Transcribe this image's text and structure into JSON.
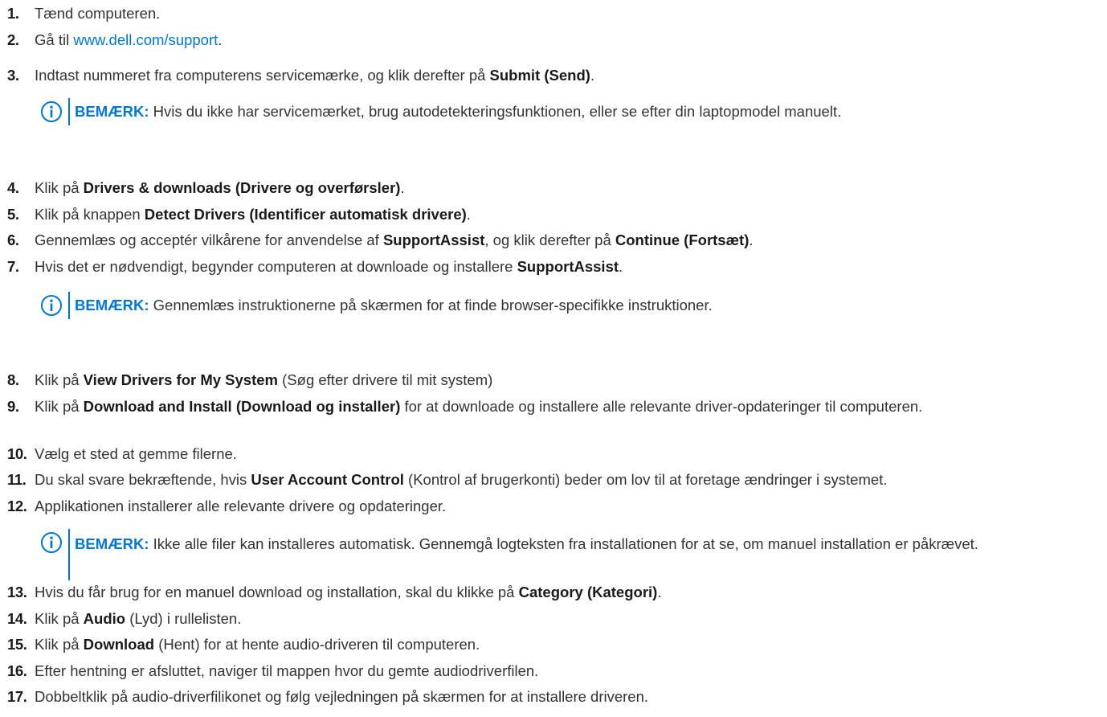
{
  "steps": [
    {
      "num": "1.",
      "text": "Tænd computeren."
    },
    {
      "num": "2.",
      "prefix": "Gå til ",
      "link": "www.dell.com/support",
      "suffix": "."
    },
    {
      "num": "3.",
      "prefix": "Indtast nummeret fra computerens servicemærke, og klik derefter på ",
      "bold": "Submit (Send)",
      "suffix": "."
    },
    {
      "num": "4.",
      "prefix": "Klik på ",
      "bold": "Drivers & downloads (Drivere og overførsler)",
      "suffix": "."
    },
    {
      "num": "5.",
      "prefix": "Klik på knappen ",
      "bold": "Detect Drivers (Identificer automatisk drivere)",
      "suffix": "."
    },
    {
      "num": "6.",
      "prefix": "Gennemlæs og acceptér vilkårene for anvendelse af ",
      "bold": "SupportAssist",
      "middle": ", og klik derefter på ",
      "bold2": "Continue (Fortsæt)",
      "suffix": "."
    },
    {
      "num": "7.",
      "prefix": "Hvis det er nødvendigt, begynder computeren at downloade og installere ",
      "bold": "SupportAssist",
      "suffix": "."
    },
    {
      "num": "8.",
      "prefix": "Klik på ",
      "bold": "View Drivers for My System",
      "suffix": " (Søg efter drivere til mit system)"
    },
    {
      "num": "9.",
      "prefix": "Klik på ",
      "bold": "Download and Install (Download og installer)",
      "suffix": " for at downloade og installere alle relevante driver-opdateringer til computeren."
    },
    {
      "num": "10.",
      "text": "Vælg et sted at gemme filerne."
    },
    {
      "num": "11.",
      "prefix": "Du skal svare bekræftende, hvis ",
      "bold": "User Account Control",
      "suffix": " (Kontrol af brugerkonti) beder om lov til at foretage ændringer i systemet."
    },
    {
      "num": "12.",
      "text": "Applikationen installerer alle relevante drivere og opdateringer."
    },
    {
      "num": "13.",
      "prefix": "Hvis du får brug for en manuel download og installation, skal du klikke på ",
      "bold": "Category (Kategori)",
      "suffix": "."
    },
    {
      "num": "14.",
      "prefix": "Klik på ",
      "bold": "Audio",
      "suffix": " (Lyd) i rullelisten."
    },
    {
      "num": "15.",
      "prefix": "Klik på ",
      "bold": "Download",
      "suffix": " (Hent) for at hente audio-driveren til computeren."
    },
    {
      "num": "16.",
      "text": "Efter hentning er afsluttet, naviger til mappen hvor du gemte audiodriverfilen."
    },
    {
      "num": "17.",
      "text": "Dobbeltklik på audio-driverfilikonet og følg vejledningen på skærmen for at installere driveren."
    }
  ],
  "notes": [
    {
      "label": "BEMÆRK:",
      "text": " Hvis du ikke har servicemærket, brug autodetekteringsfunktionen, eller se efter din laptopmodel manuelt."
    },
    {
      "label": "BEMÆRK:",
      "text": " Gennemlæs instruktionerne på skærmen for at finde browser-specifikke instruktioner."
    },
    {
      "label": "BEMÆRK:",
      "text": " Ikke alle filer kan installeres automatisk. Gennemgå logteksten fra installationen for at se, om manuel installation er påkrævet."
    }
  ],
  "icons": {
    "note": "info-icon"
  },
  "colors": {
    "accent": "#0076ce",
    "text": "#333333"
  }
}
